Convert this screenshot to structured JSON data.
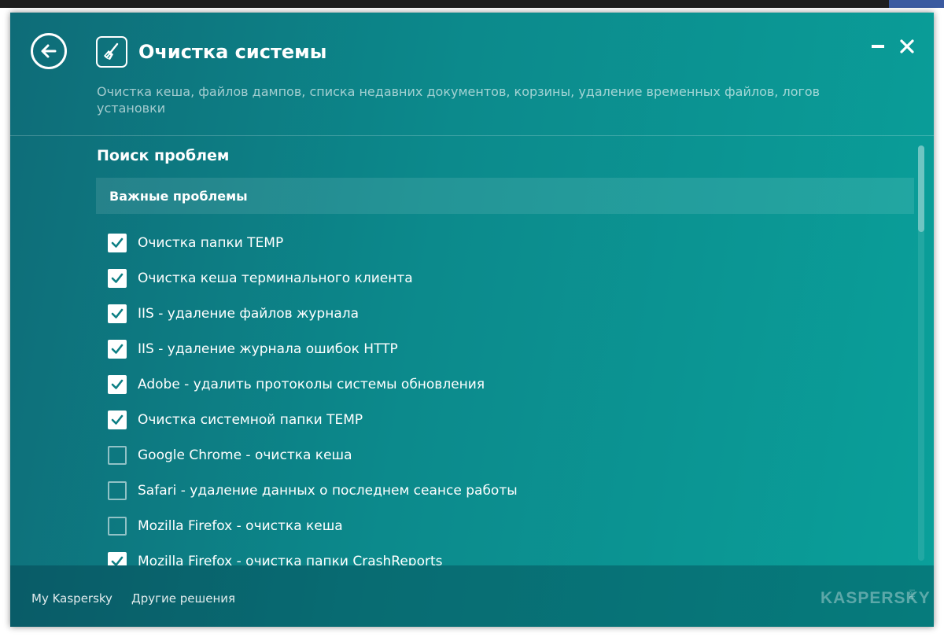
{
  "window": {
    "title": "Очистка системы",
    "subtitle": "Очистка кеша, файлов дампов, списка недавних документов, корзины, удаление временных файлов, логов установки",
    "icons": {
      "back": "back-arrow-icon",
      "app": "broom-icon",
      "minimize": "minimize-icon",
      "close": "close-icon"
    }
  },
  "content": {
    "section_title": "Поиск проблем",
    "group_title": "Важные проблемы",
    "items": [
      {
        "label": "Очистка папки TEMP",
        "checked": true
      },
      {
        "label": "Очистка кеша терминального клиента",
        "checked": true
      },
      {
        "label": "IIS - удаление файлов журнала",
        "checked": true
      },
      {
        "label": "IIS - удаление журнала ошибок HTTP",
        "checked": true
      },
      {
        "label": "Adobe - удалить протоколы системы обновления",
        "checked": true
      },
      {
        "label": "Очистка системной папки TEMP",
        "checked": true
      },
      {
        "label": "Google Chrome - очистка кеша",
        "checked": false
      },
      {
        "label": "Safari - удаление данных о последнем сеансе работы",
        "checked": false
      },
      {
        "label": "Mozilla Firefox - очистка кеша",
        "checked": false
      },
      {
        "label": "Mozilla Firefox - очистка папки CrashReports",
        "checked": true
      }
    ]
  },
  "footer": {
    "link_my": "My Kaspersky",
    "link_other": "Другие решения",
    "logo": "KASPERSKY",
    "logo_suffix": "lab"
  },
  "colors": {
    "accent_dark": "#0e6c78",
    "accent_light": "#0aa09a",
    "text": "#ffffff"
  }
}
